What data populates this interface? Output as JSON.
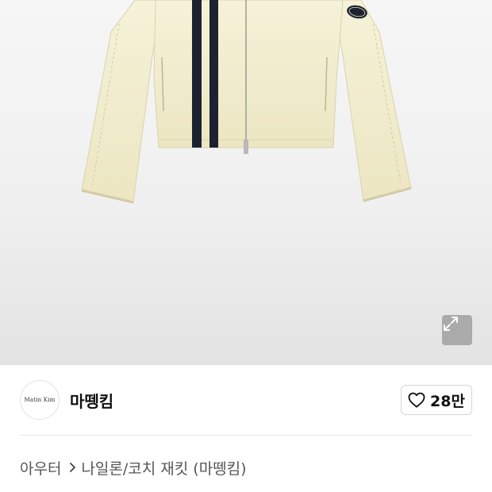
{
  "brand": {
    "logo_text": "Matin   Kim",
    "name": "마뗑킴"
  },
  "like": {
    "icon": "heart-outline-icon",
    "count": "28만"
  },
  "zoom": {
    "icon": "expand-arrows-icon"
  },
  "breadcrumb": {
    "category": "아우터",
    "separator_icon": "chevron-right-icon",
    "product": "나일론/코치 재킷 (마뗑킴)"
  },
  "colors": {
    "jacket": "#f3efd2",
    "stripe": "#1d2230",
    "image_bg": "#f0f0f0"
  }
}
